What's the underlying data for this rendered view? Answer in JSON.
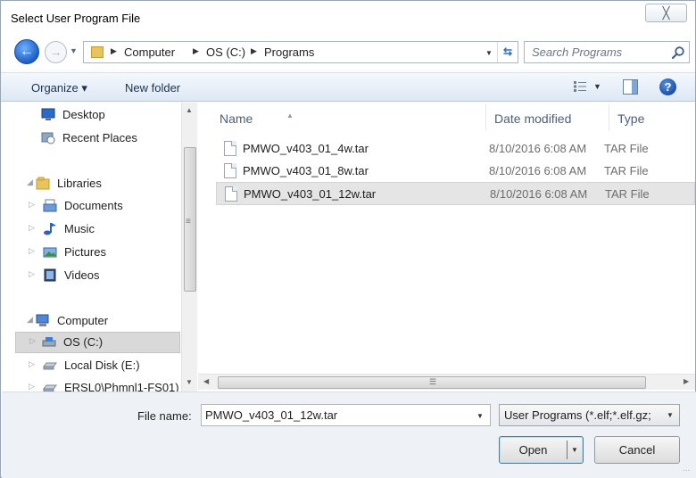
{
  "window": {
    "title": "Select User Program File",
    "close_glyph": "╳"
  },
  "address_bar": {
    "crumbs": [
      "Computer",
      "OS (C:)",
      "Programs"
    ],
    "refresh_glyph": "⇆"
  },
  "search": {
    "placeholder": "Search Programs"
  },
  "toolbar": {
    "organize_label": "Organize ▾",
    "new_folder_label": "New folder",
    "help_glyph": "?"
  },
  "nav_pane": {
    "favorites": [
      {
        "label": "Desktop",
        "icon": "desktop-icon"
      },
      {
        "label": "Recent Places",
        "icon": "recent-places-icon"
      }
    ],
    "libraries": {
      "label": "Libraries",
      "icon": "libraries-icon",
      "items": [
        {
          "label": "Documents",
          "icon": "documents-icon"
        },
        {
          "label": "Music",
          "icon": "music-icon"
        },
        {
          "label": "Pictures",
          "icon": "pictures-icon"
        },
        {
          "label": "Videos",
          "icon": "videos-icon"
        }
      ]
    },
    "computer": {
      "label": "Computer",
      "icon": "computer-icon",
      "items": [
        {
          "label": "OS (C:)",
          "icon": "drive-icon",
          "selected": true
        },
        {
          "label": "Local Disk (E:)",
          "icon": "disk-icon"
        },
        {
          "label": "ERSL0\\Phmnl1-FS01)",
          "icon": "network-drive-icon"
        }
      ]
    }
  },
  "file_list": {
    "columns": {
      "name": "Name",
      "date": "Date modified",
      "type": "Type"
    },
    "files": [
      {
        "name": "PMWO_v403_01_4w.tar",
        "date": "8/10/2016 6:08 AM",
        "type": "TAR File",
        "selected": false
      },
      {
        "name": "PMWO_v403_01_8w.tar",
        "date": "8/10/2016 6:08 AM",
        "type": "TAR File",
        "selected": false
      },
      {
        "name": "PMWO_v403_01_12w.tar",
        "date": "8/10/2016 6:08 AM",
        "type": "TAR File",
        "selected": true
      }
    ]
  },
  "footer": {
    "file_name_label": "File name:",
    "file_name_value": "PMWO_v403_01_12w.tar",
    "file_type_value": "User Programs (*.elf;*.elf.gz;",
    "open_label": "Open",
    "cancel_label": "Cancel"
  },
  "colors": {
    "toolbar_top": "#f4f8fd",
    "toolbar_bottom": "#dde8f5",
    "selection": "#e5e5e5",
    "back_button": "#1c5fc4"
  }
}
